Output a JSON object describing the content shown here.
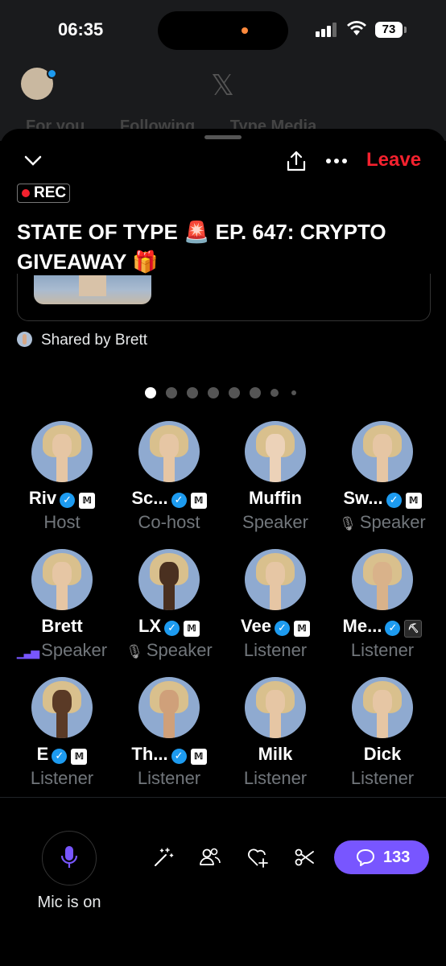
{
  "status_bar": {
    "time": "06:35",
    "battery": "73"
  },
  "background": {
    "logo": "𝕏",
    "tabs": [
      "For you",
      "Following",
      "Type Media"
    ]
  },
  "header": {
    "leave_label": "Leave",
    "rec_label": "REC"
  },
  "space": {
    "title": "STATE OF TYPE 🚨 EP. 647: CRYPTO GIVEAWAY 🎁",
    "shared_by": "Shared by Brett"
  },
  "participants": [
    {
      "name": "Riv",
      "verified": true,
      "badge": "𝕄",
      "role": "Host",
      "status": ""
    },
    {
      "name": "Sc...",
      "verified": true,
      "badge": "𝕄",
      "role": "Co-host",
      "status": ""
    },
    {
      "name": "Muffin",
      "verified": false,
      "badge": "",
      "role": "Speaker",
      "status": ""
    },
    {
      "name": "Sw...",
      "verified": true,
      "badge": "𝕄",
      "role": "Speaker",
      "status": "muted"
    },
    {
      "name": "Brett",
      "verified": false,
      "badge": "",
      "role": "Speaker",
      "status": "talking"
    },
    {
      "name": "LX",
      "verified": true,
      "badge": "𝕄",
      "role": "Speaker",
      "status": "muted"
    },
    {
      "name": "Vee",
      "verified": true,
      "badge": "𝕄",
      "role": "Listener",
      "status": ""
    },
    {
      "name": "Me...",
      "verified": true,
      "badge": "⛏",
      "role": "Listener",
      "status": ""
    },
    {
      "name": "E",
      "verified": true,
      "badge": "𝕄",
      "role": "Listener",
      "status": ""
    },
    {
      "name": "Th...",
      "verified": true,
      "badge": "𝕄",
      "role": "Listener",
      "status": ""
    },
    {
      "name": "Milk",
      "verified": false,
      "badge": "",
      "role": "Listener",
      "status": ""
    },
    {
      "name": "Dick",
      "verified": false,
      "badge": "",
      "role": "Listener",
      "status": ""
    }
  ],
  "page_indicator": {
    "count": 8,
    "active": 1
  },
  "bottom_bar": {
    "mic_label": "Mic is on",
    "tools": [
      "magic-wand-icon",
      "people-icon",
      "heart-plus-icon",
      "scissors-icon"
    ],
    "comment_count": "133"
  },
  "colors": {
    "accent": "#7856ff",
    "leave": "#f4212e",
    "verified": "#1d9bf0",
    "muted": "#f91880"
  }
}
